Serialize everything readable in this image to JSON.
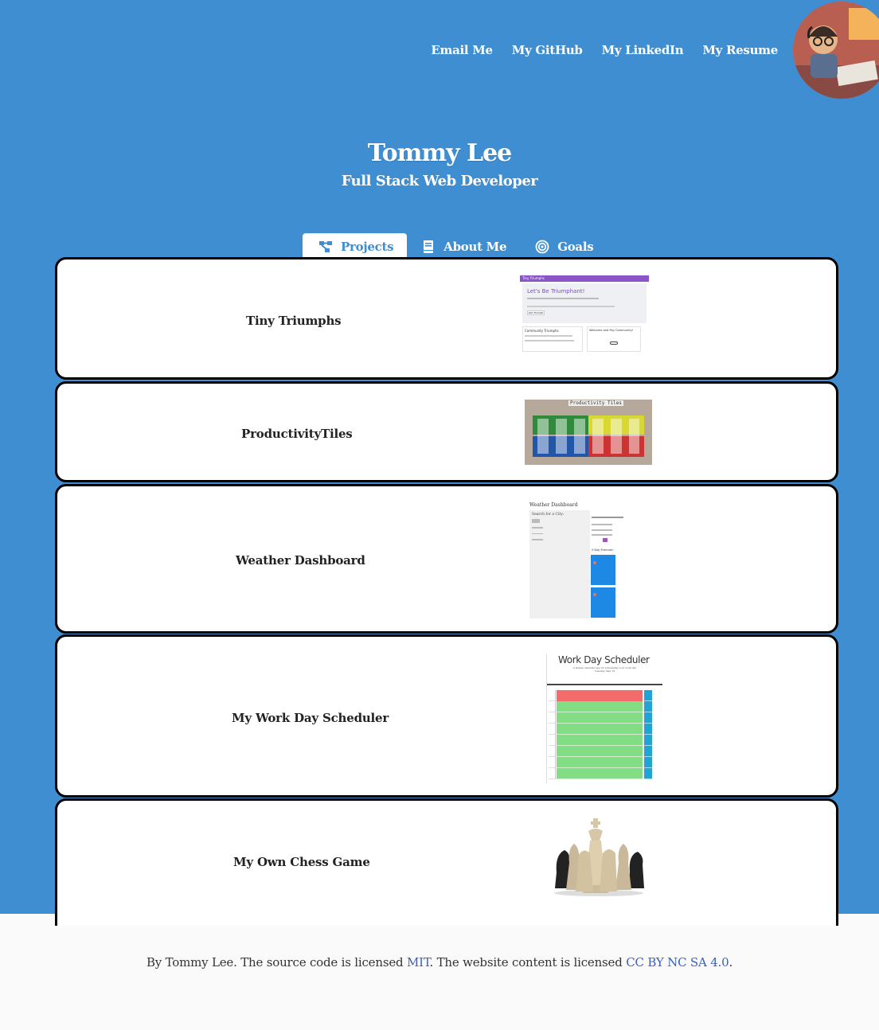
{
  "nav": {
    "links": [
      "Email Me",
      "My GitHub",
      "My LinkedIn",
      "My Resume"
    ]
  },
  "header": {
    "title": "Tommy Lee",
    "subtitle": "Full Stack Web Developer"
  },
  "tabs": [
    {
      "label": "Projects",
      "icon": "project-diagram-icon",
      "active": true
    },
    {
      "label": "About Me",
      "icon": "book-icon",
      "active": false
    },
    {
      "label": "Goals",
      "icon": "target-icon",
      "active": false
    }
  ],
  "projects": [
    {
      "name": "Tiny Triumphs",
      "thumb": {
        "brand": "Tiny Triumphs",
        "heading": "Let's Be Triumphant!",
        "button": "Add Triumph",
        "panel1": "Community Triumphs",
        "panel2": "Welcome and Pay Community!"
      }
    },
    {
      "name": "ProductivityTiles",
      "thumb": {
        "heading": "Productivity Tiles"
      }
    },
    {
      "name": "Weather Dashboard",
      "thumb": {
        "heading": "Weather Dashboard",
        "search": "Search for a City:",
        "section": "5-Day Forecast:"
      }
    },
    {
      "name": "My Work Day Scheduler",
      "thumb": {
        "heading": "Work Day Scheduler",
        "sub": "A simple calendar app for scheduling your work day",
        "date": "Tuesday, May 19"
      }
    },
    {
      "name": "My Own Chess Game",
      "thumb": {}
    }
  ],
  "footer": {
    "prefix": "By Tommy Lee. The source code is licensed ",
    "mit": "MIT",
    "middle": ". The website content is licensed ",
    "cc": "CC BY NC SA 4.0",
    "suffix": "."
  },
  "colors": {
    "hero_bg": "#3f8ed1",
    "link": "#3a5fbf"
  }
}
